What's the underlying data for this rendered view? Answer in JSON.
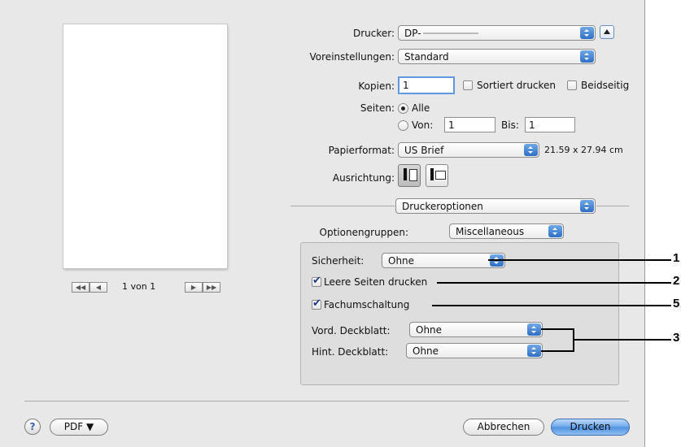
{
  "preview": {
    "page_indicator": "1 von 1",
    "nav_first": "◀◀",
    "nav_prev": "◀",
    "nav_next": "▶",
    "nav_last": "▶▶"
  },
  "printer": {
    "label": "Drucker:",
    "value": "DP-"
  },
  "presets": {
    "label": "Voreinstellungen:",
    "value": "Standard"
  },
  "copies": {
    "label": "Kopien:",
    "value": "1",
    "collate_label": "Sortiert drucken",
    "duplex_label": "Beidseitig"
  },
  "pages": {
    "label": "Seiten:",
    "all_label": "Alle",
    "from_label": "Von:",
    "from_value": "1",
    "to_label": "Bis:",
    "to_value": "1"
  },
  "paper": {
    "label": "Papierformat:",
    "value": "US Brief",
    "size": "21.59 x 27.94 cm"
  },
  "orientation": {
    "label": "Ausrichtung:"
  },
  "section": {
    "value": "Druckeroptionen"
  },
  "option_groups": {
    "label": "Optionengruppen:",
    "value": "Miscellaneous"
  },
  "options": {
    "security_label": "Sicherheit:",
    "security_value": "Ohne",
    "blank_pages_label": "Leere Seiten drucken",
    "tray_switch_label": "Fachumschaltung",
    "front_cover_label": "Vord. Deckblatt:",
    "front_cover_value": "Ohne",
    "back_cover_label": "Hint. Deckblatt:",
    "back_cover_value": "Ohne"
  },
  "annotations": {
    "n1": "1",
    "n2": "2",
    "n5": "5",
    "n3": "3"
  },
  "footer": {
    "help": "?",
    "pdf_label": "PDF ▼",
    "cancel_label": "Abbrechen",
    "print_label": "Drucken"
  },
  "colors": {
    "accent": "#4f90df",
    "dialog_bg": "#e8e8e8"
  }
}
